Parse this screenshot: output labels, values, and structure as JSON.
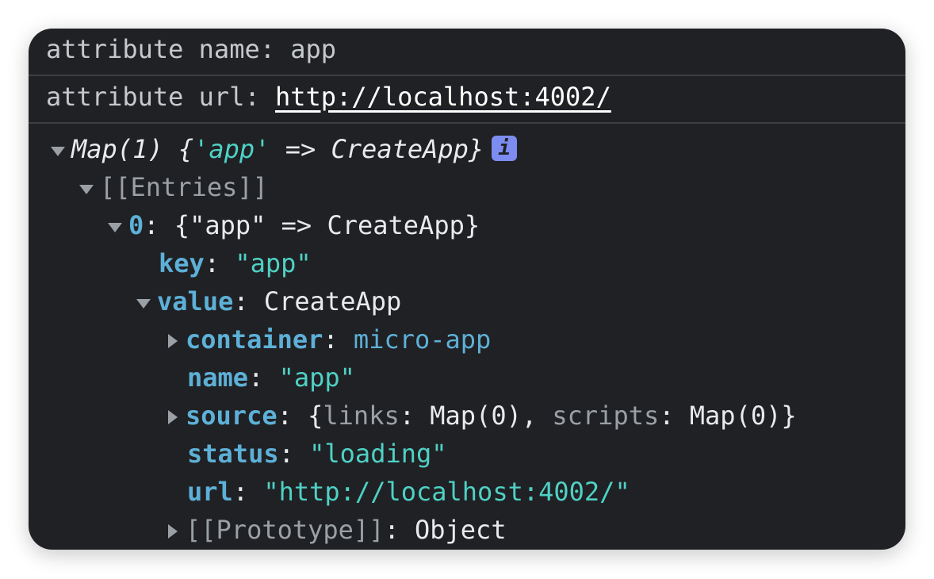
{
  "log": {
    "name_label": "attribute name: ",
    "name_value": "app",
    "url_label": "attribute url: ",
    "url_value": "http://localhost:4002/"
  },
  "map": {
    "prefix": "Map(1) {",
    "key": "'app'",
    "arrow": " => ",
    "value": "CreateApp",
    "suffix": "}",
    "info": "i"
  },
  "entries_label": "[[Entries]]",
  "entry0": {
    "index": "0",
    "sep": ": ",
    "summary": "{\"app\" => CreateApp}"
  },
  "key_row": {
    "key": "key",
    "sep": ": ",
    "value": "\"app\""
  },
  "value_row": {
    "key": "value",
    "sep": ": ",
    "value": "CreateApp"
  },
  "props": {
    "container": {
      "key": "container",
      "sep": ": ",
      "value": "micro-app"
    },
    "name": {
      "key": "name",
      "sep": ": ",
      "value": "\"app\""
    },
    "source": {
      "key": "source",
      "sep": ": ",
      "open": "{",
      "k1": "links",
      "c1": ": ",
      "v1": "Map(0)",
      "comma": ", ",
      "k2": "scripts",
      "c2": ": ",
      "v2": "Map(0)",
      "close": "}"
    },
    "status": {
      "key": "status",
      "sep": ": ",
      "value": "\"loading\""
    },
    "url": {
      "key": "url",
      "sep": ": ",
      "value": "\"http://localhost:4002/\""
    },
    "prototype": {
      "key": "[[Prototype]]",
      "sep": ": ",
      "value": "Object"
    }
  }
}
